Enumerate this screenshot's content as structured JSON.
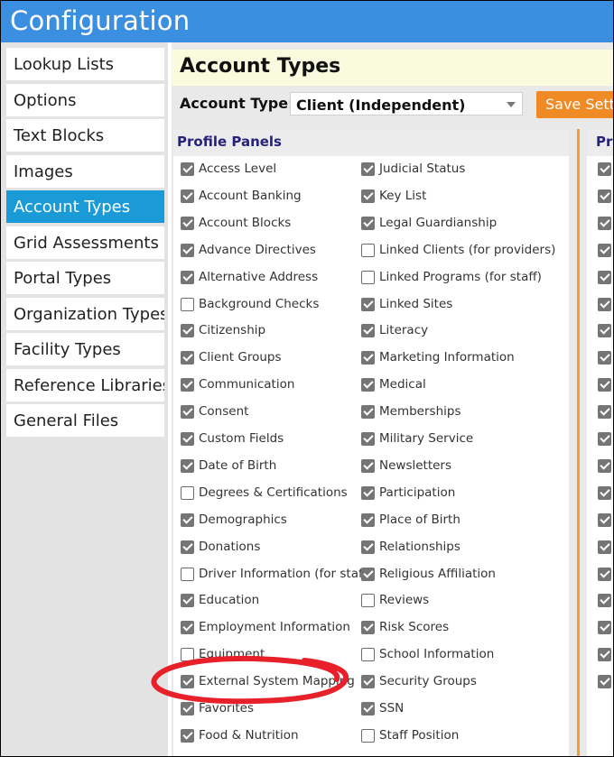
{
  "window": {
    "title": "Configuration"
  },
  "sidebar": {
    "items": [
      {
        "label": "Lookup Lists",
        "active": false
      },
      {
        "label": "Options",
        "active": false
      },
      {
        "label": "Text Blocks",
        "active": false
      },
      {
        "label": "Images",
        "active": false
      },
      {
        "label": "Account Types",
        "active": true
      },
      {
        "label": "Grid Assessments",
        "active": false
      },
      {
        "label": "Portal Types",
        "active": false
      },
      {
        "label": "Organization Types",
        "active": false
      },
      {
        "label": "Facility Types",
        "active": false
      },
      {
        "label": "Reference Libraries",
        "active": false
      },
      {
        "label": "General Files",
        "active": false
      }
    ]
  },
  "page": {
    "title": "Account Types",
    "account_type_label": "Account Type:",
    "account_type_value": "Client (Independent)",
    "save_label": "Save Setti"
  },
  "profile_panels": {
    "title": "Profile Panels",
    "left_column": [
      {
        "label": "Access Level",
        "checked": true
      },
      {
        "label": "Account Banking",
        "checked": true
      },
      {
        "label": "Account Blocks",
        "checked": true
      },
      {
        "label": "Advance Directives",
        "checked": true
      },
      {
        "label": "Alternative Address",
        "checked": true
      },
      {
        "label": "Background Checks",
        "checked": false
      },
      {
        "label": "Citizenship",
        "checked": true
      },
      {
        "label": "Client Groups",
        "checked": true
      },
      {
        "label": "Communication",
        "checked": true
      },
      {
        "label": "Consent",
        "checked": true
      },
      {
        "label": "Custom Fields",
        "checked": true
      },
      {
        "label": "Date of Birth",
        "checked": true
      },
      {
        "label": "Degrees & Certifications",
        "checked": false
      },
      {
        "label": "Demographics",
        "checked": true
      },
      {
        "label": "Donations",
        "checked": true
      },
      {
        "label": "Driver Information (for staff)",
        "checked": false
      },
      {
        "label": "Education",
        "checked": true
      },
      {
        "label": "Employment Information",
        "checked": true
      },
      {
        "label": "Equipment",
        "checked": false
      },
      {
        "label": "External System Mapping",
        "checked": true
      },
      {
        "label": "Favorites",
        "checked": true
      },
      {
        "label": "Food & Nutrition",
        "checked": true
      }
    ],
    "right_column": [
      {
        "label": "Judicial Status",
        "checked": true
      },
      {
        "label": "Key List",
        "checked": true
      },
      {
        "label": "Legal Guardianship",
        "checked": true
      },
      {
        "label": "Linked Clients (for providers)",
        "checked": false
      },
      {
        "label": "Linked Programs (for staff)",
        "checked": false
      },
      {
        "label": "Linked Sites",
        "checked": true
      },
      {
        "label": "Literacy",
        "checked": true
      },
      {
        "label": "Marketing Information",
        "checked": true
      },
      {
        "label": "Medical",
        "checked": true
      },
      {
        "label": "Memberships",
        "checked": true
      },
      {
        "label": "Military Service",
        "checked": true
      },
      {
        "label": "Newsletters",
        "checked": true
      },
      {
        "label": "Participation",
        "checked": true
      },
      {
        "label": "Place of Birth",
        "checked": true
      },
      {
        "label": "Relationships",
        "checked": true
      },
      {
        "label": "Religious Affiliation",
        "checked": true
      },
      {
        "label": "Reviews",
        "checked": false
      },
      {
        "label": "Risk Scores",
        "checked": true
      },
      {
        "label": "School Information",
        "checked": false
      },
      {
        "label": "Security Groups",
        "checked": true
      },
      {
        "label": "SSN",
        "checked": true
      },
      {
        "label": "Staff Position",
        "checked": false
      }
    ]
  },
  "second_panel": {
    "title": "Pr",
    "checked": [
      true,
      true,
      true,
      true,
      true,
      true,
      true,
      true,
      true,
      true,
      true,
      true,
      true,
      true,
      true,
      true,
      true,
      true,
      true,
      true
    ]
  },
  "annotation": {
    "color": "#e8202a"
  }
}
